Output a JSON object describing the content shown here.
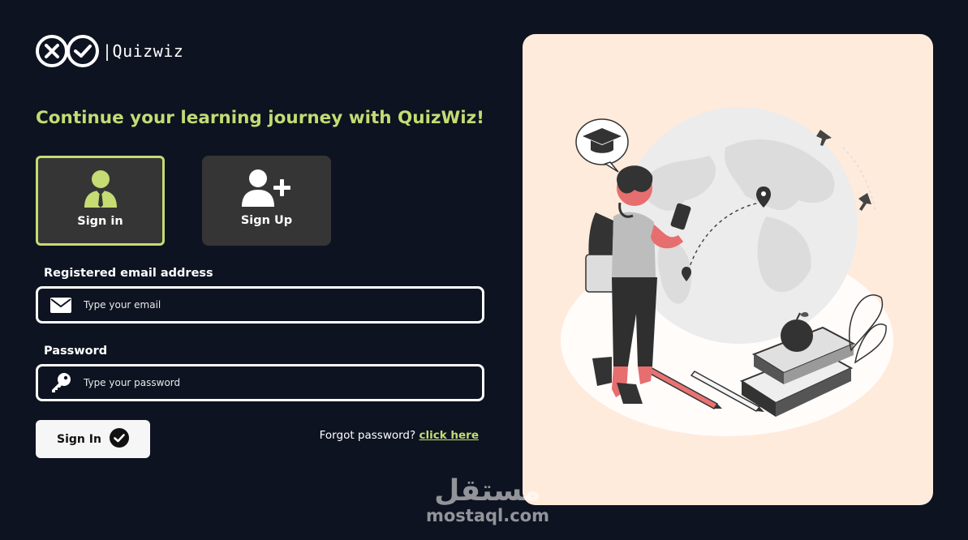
{
  "brand": {
    "name": "|Quizwiz"
  },
  "headline": "Continue your learning journey with QuizWiz!",
  "modes": [
    {
      "label": "Sign in",
      "icon": "user-icon",
      "selected": true
    },
    {
      "label": "Sign Up",
      "icon": "user-plus-icon",
      "selected": false
    }
  ],
  "form": {
    "email": {
      "label": "Registered email address",
      "placeholder": "Type your email",
      "value": "",
      "icon": "envelope-icon"
    },
    "password": {
      "label": "Password",
      "placeholder": "Type your password",
      "value": "",
      "icon": "key-icon"
    },
    "submit_label": "Sign In",
    "forgot_text": "Forgot password?",
    "forgot_link": "click here"
  },
  "watermark": {
    "arabic": "مستقل",
    "latin": "mostaql.com"
  },
  "colors": {
    "background": "#0d1320",
    "accent": "#c5db73",
    "card": "#353535",
    "illustration_bg": "#ffebdc"
  }
}
